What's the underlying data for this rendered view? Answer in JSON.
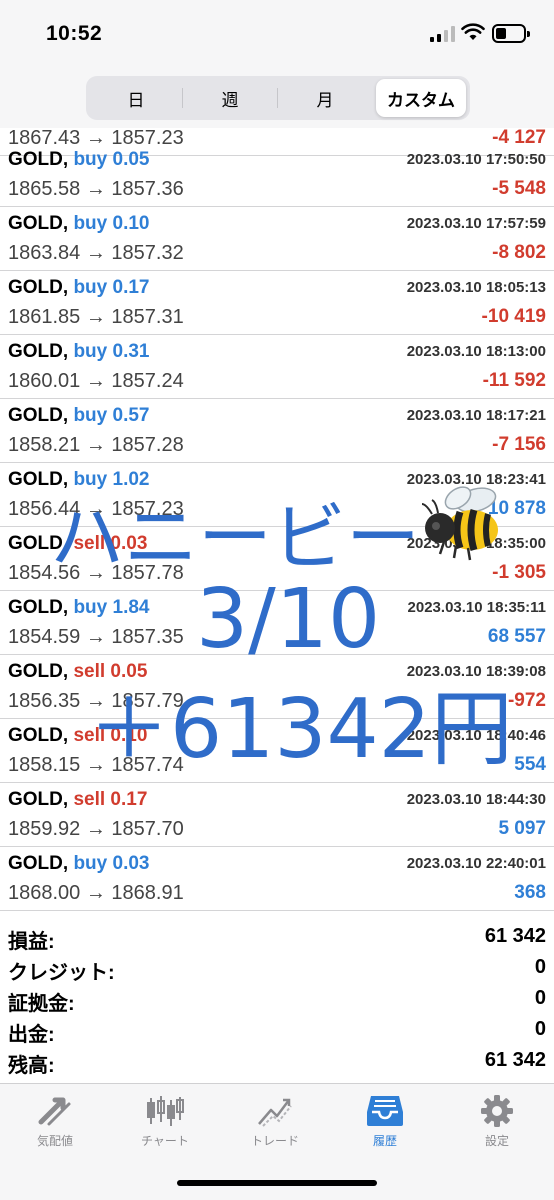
{
  "status_bar": {
    "time": "10:52"
  },
  "tabs_period": [
    "日",
    "週",
    "月",
    "カスタム"
  ],
  "active_period": "カスタム",
  "trades": [
    {
      "symbol": "GOLD,",
      "side": "buy",
      "volume": "buy 0.05",
      "time": "2023.03.10 17:50:50",
      "prices": "1865.58 → 1857.36",
      "profit": "-5 548"
    },
    {
      "symbol": "GOLD,",
      "side": "buy",
      "volume": "buy 0.10",
      "time": "2023.03.10 17:57:59",
      "prices": "1863.84 → 1857.32",
      "profit": "-8 802"
    },
    {
      "symbol": "GOLD,",
      "side": "buy",
      "volume": "buy 0.17",
      "time": "2023.03.10 18:05:13",
      "prices": "1861.85 → 1857.31",
      "profit": "-10 419"
    },
    {
      "symbol": "GOLD,",
      "side": "buy",
      "volume": "buy 0.31",
      "time": "2023.03.10 18:13:00",
      "prices": "1860.01 → 1857.24",
      "profit": "-11 592"
    },
    {
      "symbol": "GOLD,",
      "side": "buy",
      "volume": "buy 0.57",
      "time": "2023.03.10 18:17:21",
      "prices": "1858.21 → 1857.28",
      "profit": "-7 156"
    },
    {
      "symbol": "GOLD,",
      "side": "buy",
      "volume": "buy 1.02",
      "time": "2023.03.10 18:23:41",
      "prices": "1856.44 → 1857.23",
      "profit": "10 878"
    },
    {
      "symbol": "GOLD,",
      "side": "sell",
      "volume": "sell 0.03",
      "time": "2023.03.10 18:35:00",
      "prices": "1854.56 → 1857.78",
      "profit": "-1 305"
    },
    {
      "symbol": "GOLD,",
      "side": "buy",
      "volume": "buy 1.84",
      "time": "2023.03.10 18:35:11",
      "prices": "1854.59 → 1857.35",
      "profit": "68 557"
    },
    {
      "symbol": "GOLD,",
      "side": "sell",
      "volume": "sell 0.05",
      "time": "2023.03.10 18:39:08",
      "prices": "1856.35 → 1857.79",
      "profit": "-972"
    },
    {
      "symbol": "GOLD,",
      "side": "sell",
      "volume": "sell 0.10",
      "time": "2023.03.10 18:40:46",
      "prices": "1858.15 → 1857.74",
      "profit": "554"
    },
    {
      "symbol": "GOLD,",
      "side": "sell",
      "volume": "sell 0.17",
      "time": "2023.03.10 18:44:30",
      "prices": "1859.92 → 1857.70",
      "profit": "5 097"
    },
    {
      "symbol": "GOLD,",
      "side": "buy",
      "volume": "buy 0.03",
      "time": "2023.03.10 22:40:01",
      "prices": "1868.00 → 1868.91",
      "profit": "368"
    }
  ],
  "partial_row": {
    "prices": "1867.43 → 1857.23",
    "profit": "-4 127"
  },
  "summary": [
    {
      "label": "損益:",
      "value": "61 342"
    },
    {
      "label": "クレジット:",
      "value": "0"
    },
    {
      "label": "証拠金:",
      "value": "0"
    },
    {
      "label": "出金:",
      "value": "0"
    },
    {
      "label": "残高:",
      "value": "61 342"
    }
  ],
  "tabbar": [
    {
      "label": "気配値",
      "icon": "quotes-arrows-icon"
    },
    {
      "label": "チャート",
      "icon": "candlestick-icon"
    },
    {
      "label": "トレード",
      "icon": "trade-line-icon"
    },
    {
      "label": "履歴",
      "icon": "history-inbox-icon"
    },
    {
      "label": "設定",
      "icon": "gear-icon"
    }
  ],
  "active_tab": "履歴",
  "overlay": {
    "name": "ハニービー",
    "date": "3/10",
    "amount": "＋61342円"
  },
  "colors": {
    "buy": "#2f7fd6",
    "sell": "#d13c2e",
    "overlay": "#2f6cc9"
  }
}
